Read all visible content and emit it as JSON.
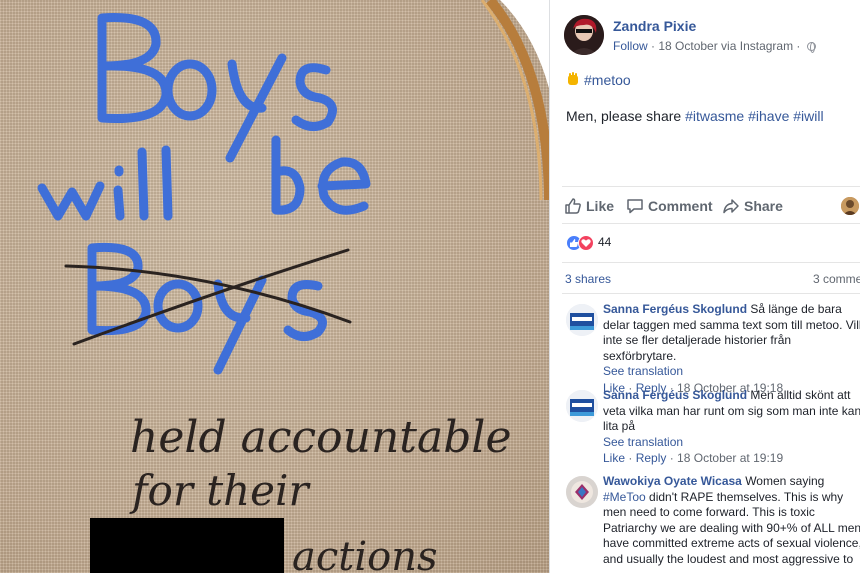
{
  "image": {
    "embroidery_line1": "Boys",
    "embroidery_line2a": "will",
    "embroidery_line2b": "be",
    "embroidery_crossed": "Boys",
    "handwriting_line1": "held accountable",
    "handwriting_line2": "for their",
    "handwriting_line3": "actions",
    "colors": {
      "blue_thread": "#3f6fd8",
      "black_thread": "#2a2320",
      "linen": "#c9b39a",
      "hoop": "#c8924c"
    }
  },
  "post": {
    "author": "Zandra Pixie",
    "follow": "Follow",
    "separator": " · ",
    "date_source": "18 October via Instagram",
    "privacy_sep": " · ",
    "tag_line": "#metoo",
    "body_prefix": "Men, please share ",
    "hashtags": [
      "#itwasme",
      "#ihave",
      "#iwill"
    ],
    "actions": {
      "like": "Like",
      "comment": "Comment",
      "share": "Share"
    },
    "reaction_count": "44",
    "shares": "3 shares",
    "comments": "3 comme",
    "colors": {
      "link": "#365899",
      "muted": "#616770",
      "like_blue": "#4a7ffb",
      "love_red": "#f3425f"
    }
  },
  "comments": [
    {
      "author": "Sanna Fergéus Skoglund",
      "text": "Så länge de bara delar taggen med samma text som till metoo. Vill inte se fler detaljerade historier från sexförbrytare.",
      "translation": "See translation",
      "like": "Like",
      "reply": "Reply",
      "time": "18 October at 19:18"
    },
    {
      "author": "Sanna Fergéus Skoglund",
      "text": "Men alltid skönt att veta vilka man har runt om sig som man inte kan lita på",
      "translation": "See translation",
      "like": "Like",
      "reply": "Reply",
      "time": "18 October at 19:19"
    },
    {
      "author": "Wawokiya Oyate Wicasa",
      "text_before": "Women saying ",
      "hashtag": "#MeToo",
      "text_after": " didn't RAPE themselves. This is why men need to come forward. This is toxic Patriarchy we are dealing with 90+% of ALL men have committed extreme acts of sexual violence, and usually the loudest and most aggressive to"
    }
  ]
}
